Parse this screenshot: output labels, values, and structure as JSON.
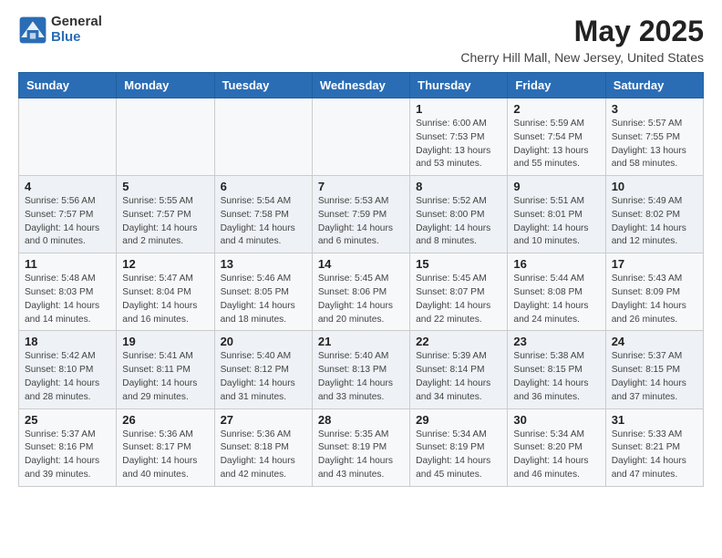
{
  "logo": {
    "general": "General",
    "blue": "Blue"
  },
  "title": "May 2025",
  "location": "Cherry Hill Mall, New Jersey, United States",
  "headers": [
    "Sunday",
    "Monday",
    "Tuesday",
    "Wednesday",
    "Thursday",
    "Friday",
    "Saturday"
  ],
  "weeks": [
    [
      {
        "day": "",
        "info": ""
      },
      {
        "day": "",
        "info": ""
      },
      {
        "day": "",
        "info": ""
      },
      {
        "day": "",
        "info": ""
      },
      {
        "day": "1",
        "info": "Sunrise: 6:00 AM\nSunset: 7:53 PM\nDaylight: 13 hours\nand 53 minutes."
      },
      {
        "day": "2",
        "info": "Sunrise: 5:59 AM\nSunset: 7:54 PM\nDaylight: 13 hours\nand 55 minutes."
      },
      {
        "day": "3",
        "info": "Sunrise: 5:57 AM\nSunset: 7:55 PM\nDaylight: 13 hours\nand 58 minutes."
      }
    ],
    [
      {
        "day": "4",
        "info": "Sunrise: 5:56 AM\nSunset: 7:57 PM\nDaylight: 14 hours\nand 0 minutes."
      },
      {
        "day": "5",
        "info": "Sunrise: 5:55 AM\nSunset: 7:57 PM\nDaylight: 14 hours\nand 2 minutes."
      },
      {
        "day": "6",
        "info": "Sunrise: 5:54 AM\nSunset: 7:58 PM\nDaylight: 14 hours\nand 4 minutes."
      },
      {
        "day": "7",
        "info": "Sunrise: 5:53 AM\nSunset: 7:59 PM\nDaylight: 14 hours\nand 6 minutes."
      },
      {
        "day": "8",
        "info": "Sunrise: 5:52 AM\nSunset: 8:00 PM\nDaylight: 14 hours\nand 8 minutes."
      },
      {
        "day": "9",
        "info": "Sunrise: 5:51 AM\nSunset: 8:01 PM\nDaylight: 14 hours\nand 10 minutes."
      },
      {
        "day": "10",
        "info": "Sunrise: 5:49 AM\nSunset: 8:02 PM\nDaylight: 14 hours\nand 12 minutes."
      }
    ],
    [
      {
        "day": "11",
        "info": "Sunrise: 5:48 AM\nSunset: 8:03 PM\nDaylight: 14 hours\nand 14 minutes."
      },
      {
        "day": "12",
        "info": "Sunrise: 5:47 AM\nSunset: 8:04 PM\nDaylight: 14 hours\nand 16 minutes."
      },
      {
        "day": "13",
        "info": "Sunrise: 5:46 AM\nSunset: 8:05 PM\nDaylight: 14 hours\nand 18 minutes."
      },
      {
        "day": "14",
        "info": "Sunrise: 5:45 AM\nSunset: 8:06 PM\nDaylight: 14 hours\nand 20 minutes."
      },
      {
        "day": "15",
        "info": "Sunrise: 5:45 AM\nSunset: 8:07 PM\nDaylight: 14 hours\nand 22 minutes."
      },
      {
        "day": "16",
        "info": "Sunrise: 5:44 AM\nSunset: 8:08 PM\nDaylight: 14 hours\nand 24 minutes."
      },
      {
        "day": "17",
        "info": "Sunrise: 5:43 AM\nSunset: 8:09 PM\nDaylight: 14 hours\nand 26 minutes."
      }
    ],
    [
      {
        "day": "18",
        "info": "Sunrise: 5:42 AM\nSunset: 8:10 PM\nDaylight: 14 hours\nand 28 minutes."
      },
      {
        "day": "19",
        "info": "Sunrise: 5:41 AM\nSunset: 8:11 PM\nDaylight: 14 hours\nand 29 minutes."
      },
      {
        "day": "20",
        "info": "Sunrise: 5:40 AM\nSunset: 8:12 PM\nDaylight: 14 hours\nand 31 minutes."
      },
      {
        "day": "21",
        "info": "Sunrise: 5:40 AM\nSunset: 8:13 PM\nDaylight: 14 hours\nand 33 minutes."
      },
      {
        "day": "22",
        "info": "Sunrise: 5:39 AM\nSunset: 8:14 PM\nDaylight: 14 hours\nand 34 minutes."
      },
      {
        "day": "23",
        "info": "Sunrise: 5:38 AM\nSunset: 8:15 PM\nDaylight: 14 hours\nand 36 minutes."
      },
      {
        "day": "24",
        "info": "Sunrise: 5:37 AM\nSunset: 8:15 PM\nDaylight: 14 hours\nand 37 minutes."
      }
    ],
    [
      {
        "day": "25",
        "info": "Sunrise: 5:37 AM\nSunset: 8:16 PM\nDaylight: 14 hours\nand 39 minutes."
      },
      {
        "day": "26",
        "info": "Sunrise: 5:36 AM\nSunset: 8:17 PM\nDaylight: 14 hours\nand 40 minutes."
      },
      {
        "day": "27",
        "info": "Sunrise: 5:36 AM\nSunset: 8:18 PM\nDaylight: 14 hours\nand 42 minutes."
      },
      {
        "day": "28",
        "info": "Sunrise: 5:35 AM\nSunset: 8:19 PM\nDaylight: 14 hours\nand 43 minutes."
      },
      {
        "day": "29",
        "info": "Sunrise: 5:34 AM\nSunset: 8:19 PM\nDaylight: 14 hours\nand 45 minutes."
      },
      {
        "day": "30",
        "info": "Sunrise: 5:34 AM\nSunset: 8:20 PM\nDaylight: 14 hours\nand 46 minutes."
      },
      {
        "day": "31",
        "info": "Sunrise: 5:33 AM\nSunset: 8:21 PM\nDaylight: 14 hours\nand 47 minutes."
      }
    ]
  ]
}
